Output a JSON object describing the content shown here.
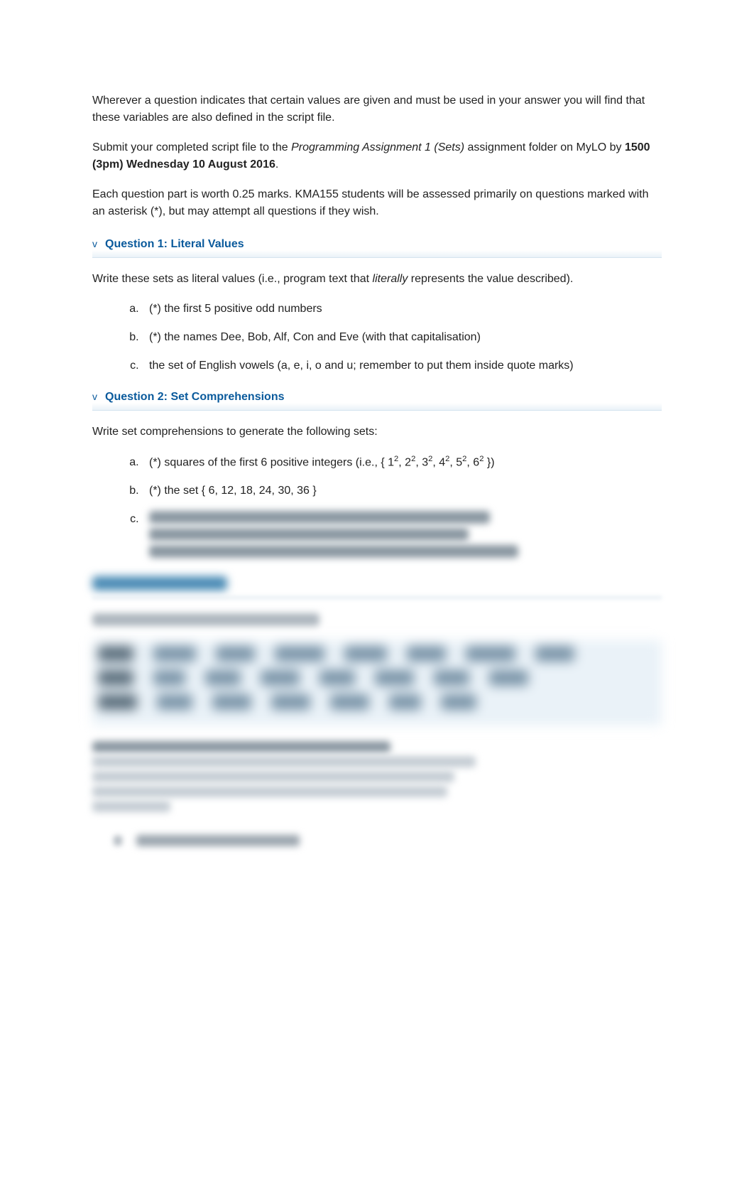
{
  "intro": {
    "p1": "Wherever a question indicates that certain values are given and must be used in your answer you will find that these variables are also defined in the script file.",
    "p2a": "Submit your completed script file to the ",
    "p2_italic": "Programming Assignment 1 (Sets)",
    "p2b": " assignment folder on MyLO by ",
    "p2_bold": "1500 (3pm) Wednesday 10 August 2016",
    "p2c": ".",
    "p3": "Each question part is worth 0.25 marks. KMA155 students will be assessed primarily on questions marked with an asterisk (*), but may attempt all questions if they wish."
  },
  "q1": {
    "header": "Question 1: Literal Values",
    "intro_a": "Write these sets as literal values (i.e., program text that ",
    "intro_italic": "literally",
    "intro_b": " represents the value described).",
    "items": {
      "a": "(*) the first 5 positive odd numbers",
      "b": "(*) the names Dee, Bob, Alf, Con and Eve (with that capitalisation)",
      "c": "the set of English vowels (a, e, i, o and u; remember to put them inside quote marks)"
    }
  },
  "q2": {
    "header": "Question 2: Set Comprehensions",
    "intro": "Write set comprehensions to generate the following sets:",
    "items": {
      "a_pre": "(*) squares of the first 6 positive integers (i.e., { 1",
      "a_s1": "2",
      "a_2": ", 2",
      "a_s2": "2",
      "a_3": ", 3",
      "a_s3": "2",
      "a_4": ", 4",
      "a_s4": "2",
      "a_5": ", 5",
      "a_s5": "2",
      "a_6": ", 6",
      "a_s6": "2",
      "a_post": " })",
      "b": "(*) the set { 6, 12, 18, 24, 30, 36 }"
    }
  }
}
